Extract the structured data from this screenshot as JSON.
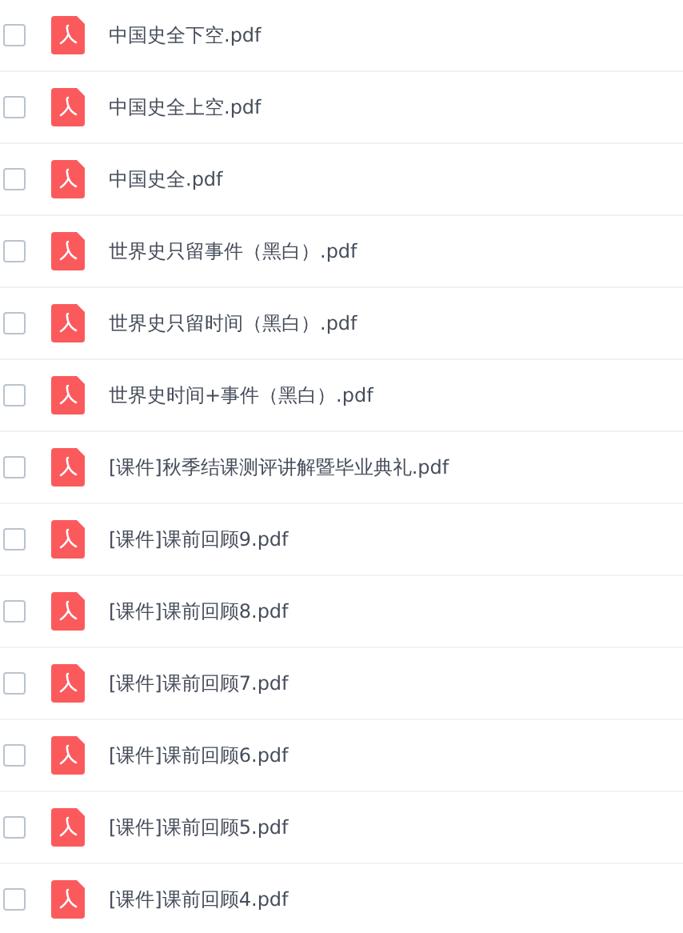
{
  "files": [
    {
      "name": "中国史全下空.pdf",
      "checked": false
    },
    {
      "name": "中国史全上空.pdf",
      "checked": false
    },
    {
      "name": "中国史全.pdf",
      "checked": false
    },
    {
      "name": "世界史只留事件（黑白）.pdf",
      "checked": false
    },
    {
      "name": "世界史只留时间（黑白）.pdf",
      "checked": false
    },
    {
      "name": "世界史时间+事件（黑白）.pdf",
      "checked": false
    },
    {
      "name": "[课件]秋季结课测评讲解暨毕业典礼.pdf",
      "checked": false
    },
    {
      "name": "[课件]课前回顾9.pdf",
      "checked": false
    },
    {
      "name": "[课件]课前回顾8.pdf",
      "checked": false
    },
    {
      "name": "[课件]课前回顾7.pdf",
      "checked": false
    },
    {
      "name": "[课件]课前回顾6.pdf",
      "checked": false
    },
    {
      "name": "[课件]课前回顾5.pdf",
      "checked": false
    },
    {
      "name": "[课件]课前回顾4.pdf",
      "checked": false
    }
  ]
}
